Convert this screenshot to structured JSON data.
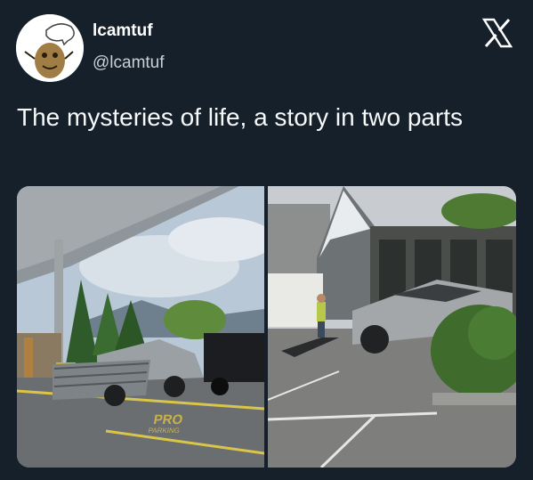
{
  "author": {
    "display_name": "lcamtuf",
    "handle": "@lcamtuf",
    "avatar_icon": "potato-character-avatar"
  },
  "platform": {
    "logo_icon": "x-logo-icon"
  },
  "tweet": {
    "text": "The mysteries of life, a story in two parts"
  },
  "media": {
    "left_photo": {
      "description_icon": "photo-truck-parking-lot",
      "pavement_text": "PRO",
      "pavement_subtext": "PARKING"
    },
    "right_photo": {
      "description_icon": "photo-cybertruck-store"
    }
  },
  "colors": {
    "background": "#15202b",
    "text": "#ffffff",
    "secondary_text": "#c9d0d6"
  }
}
